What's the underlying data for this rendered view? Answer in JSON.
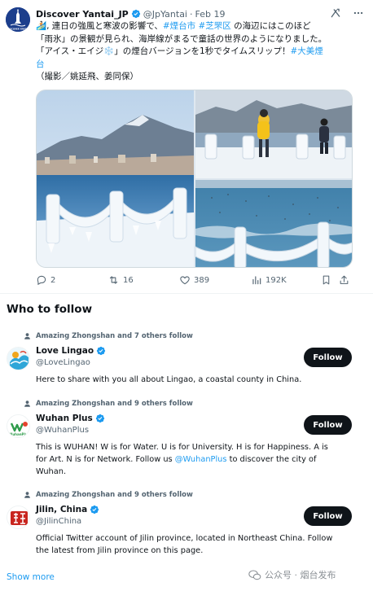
{
  "tweet": {
    "author_name": "Discover Yantai_JP",
    "author_handle": "@JpYantai",
    "separator": "·",
    "date": "Feb 19",
    "avatar_text": "DISCOVER YANTAI",
    "body_lines": [
      {
        "segments": [
          {
            "text": "🏄🏻, 連日の強風と寒波の影響で、",
            "hl": false
          },
          {
            "text": "#煙台市",
            "hl": true
          },
          {
            "text": " ",
            "hl": false
          },
          {
            "text": "#芝罘区",
            "hl": true
          },
          {
            "text": " の海辺にはこのほど",
            "hl": false
          }
        ]
      },
      {
        "segments": [
          {
            "text": "「雨氷」の景観が見られ、海岸線がまるで童話の世界のようになりました。",
            "hl": false
          }
        ]
      },
      {
        "segments": [
          {
            "text": "「アイス・エイジ❄️」の煙台バージョンを1秒でタイムスリップ！",
            "hl": false
          },
          {
            "text": "#大美煙",
            "hl": true
          }
        ]
      },
      {
        "segments": [
          {
            "text": "台",
            "hl": true
          }
        ]
      },
      {
        "segments": [
          {
            "text": "（撮影／姚延飛、姜同保）",
            "hl": false
          }
        ]
      }
    ],
    "stats": {
      "replies": "2",
      "retweets": "16",
      "likes": "389",
      "views": "192K"
    }
  },
  "who_to_follow": {
    "title": "Who to follow",
    "show_more": "Show more",
    "items": [
      {
        "context": "Amazing Zhongshan and 7 others follow",
        "name": "Love Lingao",
        "handle": "@LoveLingao",
        "follow_label": "Follow",
        "bio_lines": [
          [
            {
              "text": "Here to share with you all about Lingao, a coastal county in China.",
              "mention": false
            }
          ]
        ]
      },
      {
        "context": "Amazing Zhongshan and 9 others follow",
        "name": "Wuhan Plus",
        "handle": "@WuhanPlus",
        "follow_label": "Follow",
        "avatar_text": "WuhanPlus",
        "bio_lines": [
          [
            {
              "text": "This is WUHAN! W is for Water. U is for University. H is for Happiness. A is",
              "mention": false
            }
          ],
          [
            {
              "text": "for Art. N is for Network. Follow us ",
              "mention": false
            },
            {
              "text": "@WuhanPlus",
              "mention": true
            },
            {
              "text": " to discover the city of",
              "mention": false
            }
          ],
          [
            {
              "text": "Wuhan.",
              "mention": false
            }
          ]
        ]
      },
      {
        "context": "Amazing Zhongshan and 9 others follow",
        "name": "Jilin, China",
        "handle": "@JilinChina",
        "follow_label": "Follow",
        "bio_lines": [
          [
            {
              "text": "Official Twitter account of Jilin province, located in Northeast China. Follow",
              "mention": false
            }
          ],
          [
            {
              "text": "the latest from Jilin province on this page.",
              "mention": false
            }
          ]
        ]
      }
    ]
  },
  "watermark": {
    "text": "公众号 · 烟台发布"
  },
  "colors": {
    "link": "#1d9bf0",
    "text": "#0f1419",
    "secondary": "#536471",
    "verified": "#1d9bf0",
    "follow_bg": "#0f1419"
  }
}
